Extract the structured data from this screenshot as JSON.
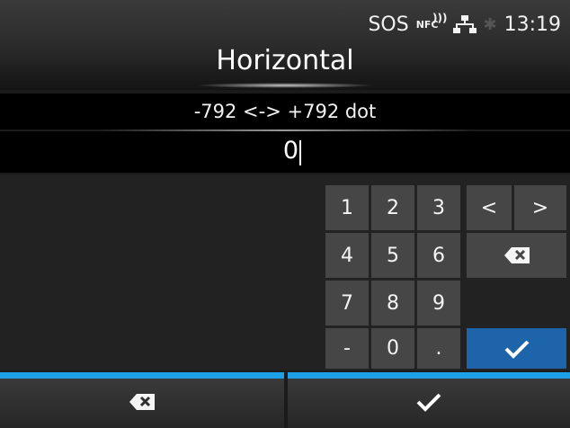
{
  "status": {
    "sos": "SOS",
    "nfc": "NFC",
    "time": "13:19",
    "icons": [
      "nfc-icon",
      "lan-icon",
      "bluetooth-icon"
    ]
  },
  "title": "Horizontal",
  "range": "-792 <-> +792 dot",
  "value": "0",
  "keypad": {
    "digits": [
      "1",
      "2",
      "3",
      "4",
      "5",
      "6",
      "7",
      "8",
      "9"
    ],
    "minus": "-",
    "zero": "0",
    "dot": ".",
    "left": "<",
    "right": ">",
    "backspace_icon": "backspace-icon",
    "enter_icon": "check-icon"
  },
  "softkeys": {
    "left_icon": "backspace-icon",
    "right_icon": "check-icon"
  },
  "colors": {
    "accent": "#1ea0e6",
    "enter": "#1e64aa",
    "key": "#464646",
    "background": "#222222"
  }
}
